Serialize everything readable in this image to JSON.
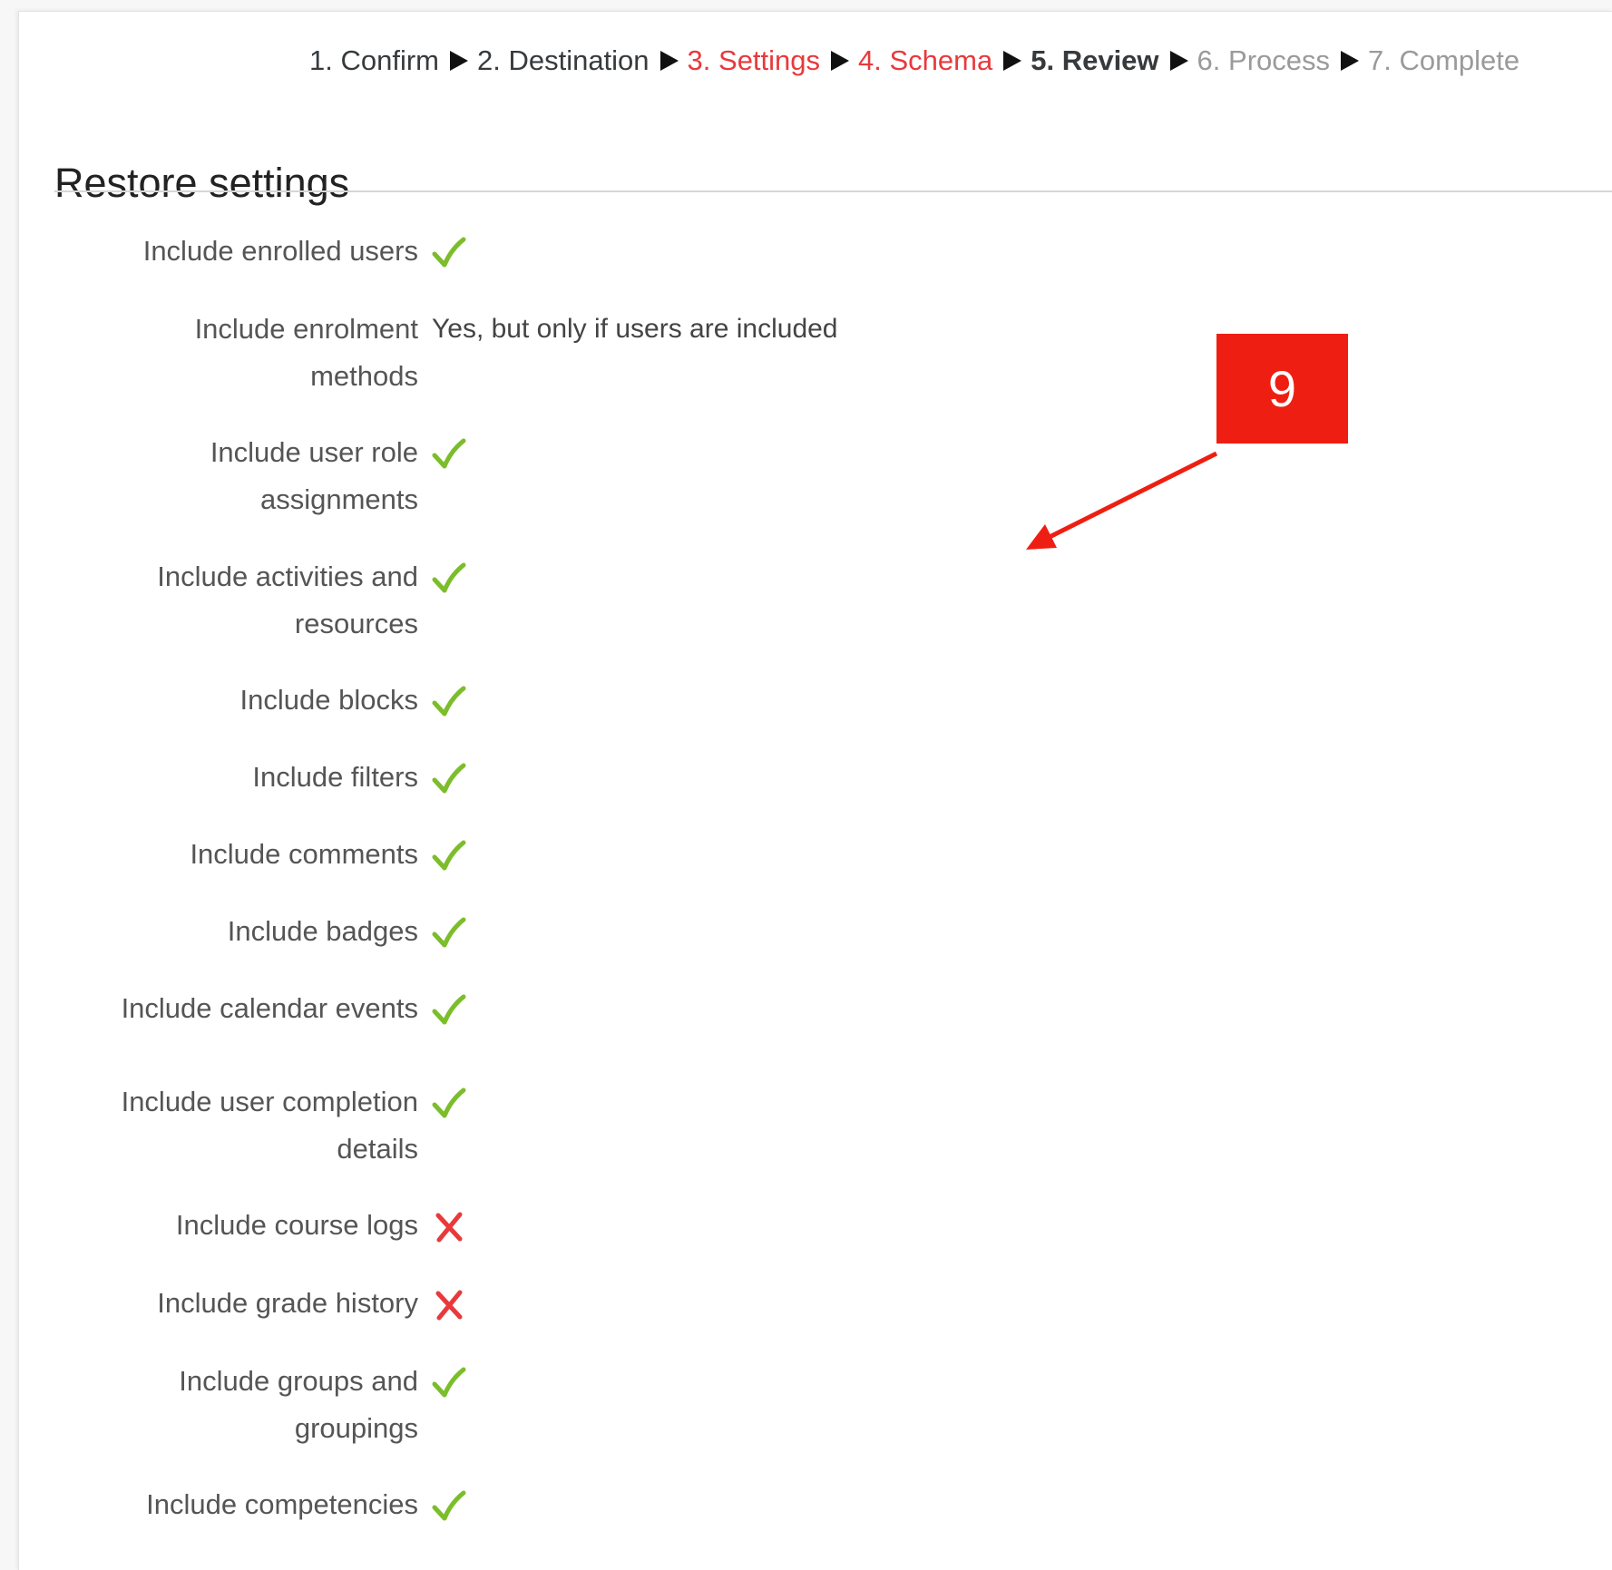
{
  "steps": [
    {
      "label": "1. Confirm",
      "state": "done"
    },
    {
      "label": "2. Destination",
      "state": "done"
    },
    {
      "label": "3. Settings",
      "state": "visited"
    },
    {
      "label": "4. Schema",
      "state": "visited"
    },
    {
      "label": "5. Review",
      "state": "current"
    },
    {
      "label": "6. Process",
      "state": "future"
    },
    {
      "label": "7. Complete",
      "state": "future"
    }
  ],
  "section": {
    "title": "Restore settings"
  },
  "settings": [
    {
      "line1": "Include enrolled users",
      "line2": "",
      "status": "check"
    },
    {
      "line1": "Include enrolment",
      "line2": "methods",
      "status": "text",
      "value": "Yes, but only if users are included"
    },
    {
      "line1": "Include user role",
      "line2": "assignments",
      "status": "check"
    },
    {
      "line1": "Include activities and",
      "line2": "resources",
      "status": "check"
    },
    {
      "line1": "Include blocks",
      "line2": "",
      "status": "check"
    },
    {
      "line1": "Include filters",
      "line2": "",
      "status": "check"
    },
    {
      "line1": "Include comments",
      "line2": "",
      "status": "check"
    },
    {
      "line1": "Include badges",
      "line2": "",
      "status": "check"
    },
    {
      "line1": "Include calendar events",
      "line2": "",
      "status": "check"
    },
    {
      "line1": "Include user completion",
      "line2": "details",
      "status": "check"
    },
    {
      "line1": "Include course logs",
      "line2": "",
      "status": "cross"
    },
    {
      "line1": "Include grade history",
      "line2": "",
      "status": "cross"
    },
    {
      "line1": "Include groups and",
      "line2": "groupings",
      "status": "check"
    },
    {
      "line1": "Include competencies",
      "line2": "",
      "status": "check"
    }
  ],
  "callout": {
    "number": "9"
  },
  "colors": {
    "check": "#7cbd2b",
    "cross": "#e8393c",
    "visited_step": "#e8393c",
    "callout": "#ee1f12"
  },
  "icons": {
    "check": "check-icon",
    "cross": "cross-icon",
    "step_separator": "triangle-right-icon"
  }
}
